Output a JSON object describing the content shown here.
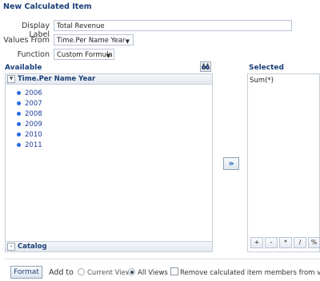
{
  "dialog": {
    "title": "New Calculated Item"
  },
  "form": {
    "display_label": {
      "label": "Display Label",
      "value": "Total Revenue"
    },
    "values_from": {
      "label": "Values From",
      "value": "Time.Per Name Year"
    },
    "function": {
      "label": "Function",
      "value": "Custom Formula"
    }
  },
  "available": {
    "heading": "Available",
    "tree_header": "Time.Per Name Year",
    "members": [
      "2006",
      "2007",
      "2008",
      "2009",
      "2010",
      "2011"
    ],
    "catalog_label": "Catalog"
  },
  "move_button": {
    "label": "»"
  },
  "selected": {
    "heading": "Selected",
    "formula": "Sum(*)",
    "operators": [
      "+",
      "-",
      "*",
      "/",
      "%"
    ]
  },
  "footer": {
    "format_label": "Format",
    "add_to_label": "Add to",
    "current_view_label": "Current View",
    "all_views_label": "All Views",
    "selected_option": "All Views",
    "remove_members_label": "Remove calculated item members from view",
    "remove_members_checked": false
  }
}
